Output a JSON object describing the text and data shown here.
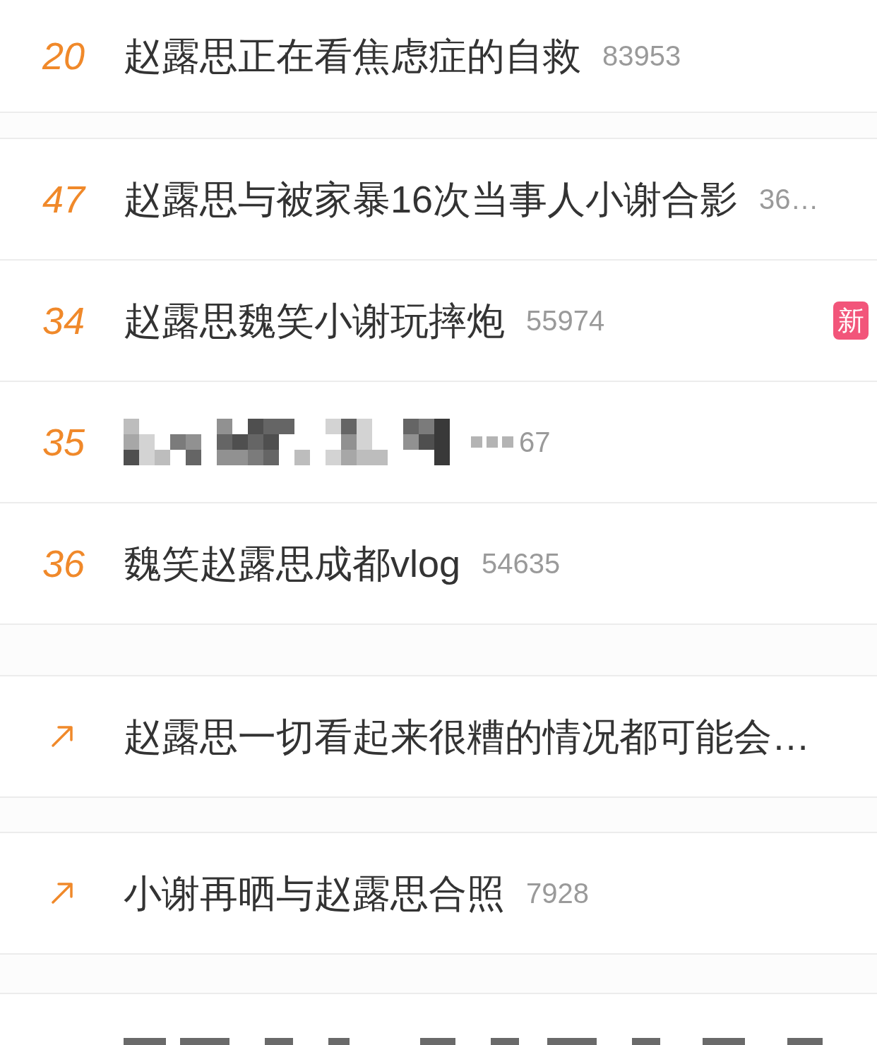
{
  "sections": [
    {
      "items": [
        {
          "kind": "ranked",
          "rank": "20",
          "pixelated": false,
          "title": "赵露思正在看焦虑症的自救",
          "count": "83953"
        }
      ]
    },
    {
      "items": [
        {
          "kind": "ranked",
          "rank": "47",
          "pixelated": false,
          "title": "赵露思与被家暴16次当事人小谢合影",
          "count": "36…"
        },
        {
          "kind": "ranked",
          "rank": "34",
          "pixelated": false,
          "title": "赵露思魏笑小谢玩摔炮",
          "count": "55974",
          "badge": "新"
        },
        {
          "kind": "ranked",
          "rank": "35",
          "pixelated": true,
          "count": "67"
        },
        {
          "kind": "ranked",
          "rank": "36",
          "pixelated": false,
          "title": "魏笑赵露思成都vlog",
          "count": "54635"
        }
      ]
    },
    {
      "items": [
        {
          "kind": "rising",
          "pixelated": false,
          "title": "赵露思一切看起来很糟的情况都可能会…"
        }
      ]
    },
    {
      "items": [
        {
          "kind": "rising",
          "pixelated": false,
          "title": "小谢再晒与赵露思合照",
          "count": "7928"
        }
      ]
    },
    {
      "items": [
        {
          "kind": "obscured"
        }
      ]
    }
  ]
}
